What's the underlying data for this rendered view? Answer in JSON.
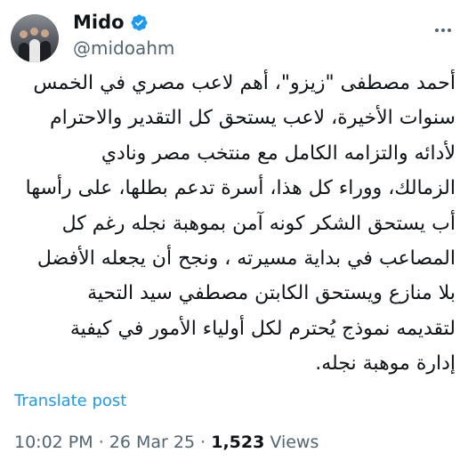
{
  "author": {
    "display_name": "Mido",
    "handle": "@midoahm",
    "verified": true,
    "avatar_icon": "profile-photo-avatar"
  },
  "post": {
    "lines": [
      "أحمد مصطفى \"زيزو\"، أهم لاعب مصري في الخمس",
      "سنوات الأخيرة، لاعب يستحق كل التقدير والاحترام",
      "لأدائه والتزامه الكامل مع  منتخب مصر ونادي",
      "الزمالك، ووراء كل هذا، أسرة تدعم بطلها، على رأسها",
      "أب يستحق الشكر كونه آمن بموهبة نجله رغم كل",
      "المصاعب في بداية مسيرته ، ونجح أن يجعله الأفضل",
      "بلا منازع ويستحق الكابتن مصطفي سيد التحية",
      "لتقديمه نموذج يُحترم لكل أولياء الأمور في  كيفية",
      "إدارة موهبة نجله."
    ],
    "translate_label": "Translate post"
  },
  "meta": {
    "time": "10:02 PM",
    "separator": "·",
    "date": "26 Mar 25",
    "views_count": "1,523",
    "views_label": "Views"
  },
  "colors": {
    "accent": "#1d9bf0",
    "text_primary": "#0f1419",
    "text_secondary": "#536471"
  }
}
